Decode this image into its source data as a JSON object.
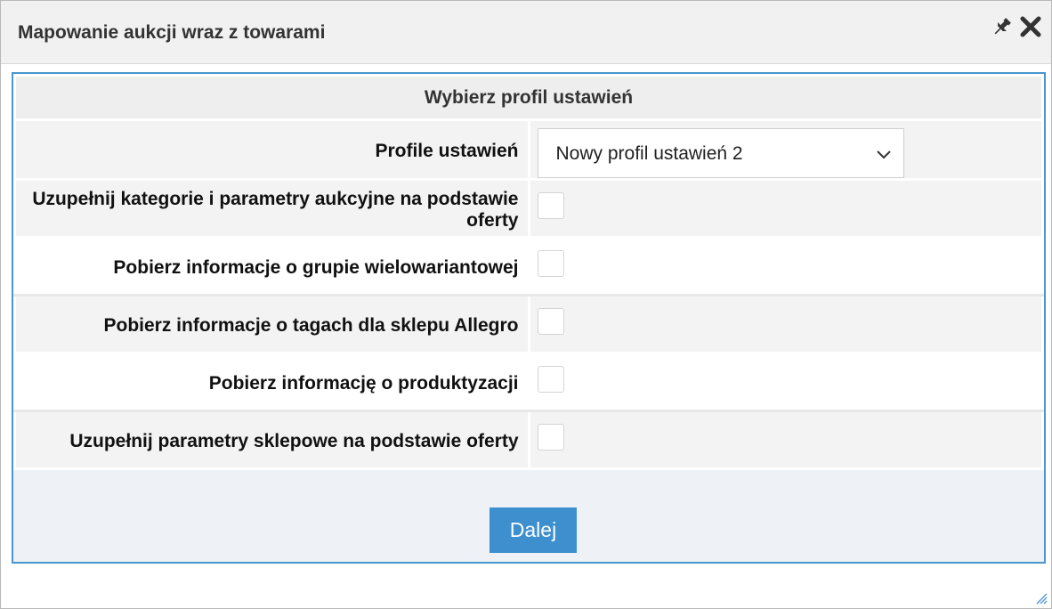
{
  "dialog": {
    "title": "Mapowanie aukcji wraz z towarami",
    "icons": [
      "pin-icon",
      "close-icon"
    ]
  },
  "panel": {
    "header": "Wybierz profil ustawień",
    "profile": {
      "label": "Profile ustawień",
      "selected": "Nowy profil ustawień 2"
    },
    "options": [
      {
        "label": "Uzupełnij kategorie i parametry aukcyjne na podstawie oferty",
        "checked": false
      },
      {
        "label": "Pobierz informacje o grupie wielowariantowej",
        "checked": false
      },
      {
        "label": "Pobierz informacje o tagach dla sklepu Allegro",
        "checked": false
      },
      {
        "label": "Pobierz informację o produktyzacji",
        "checked": false
      },
      {
        "label": "Uzupełnij parametry sklepowe na podstawie oferty",
        "checked": false
      }
    ],
    "next_button": "Dalej"
  },
  "colors": {
    "accent": "#3d8fcd",
    "panel_border": "#4a96cf"
  }
}
